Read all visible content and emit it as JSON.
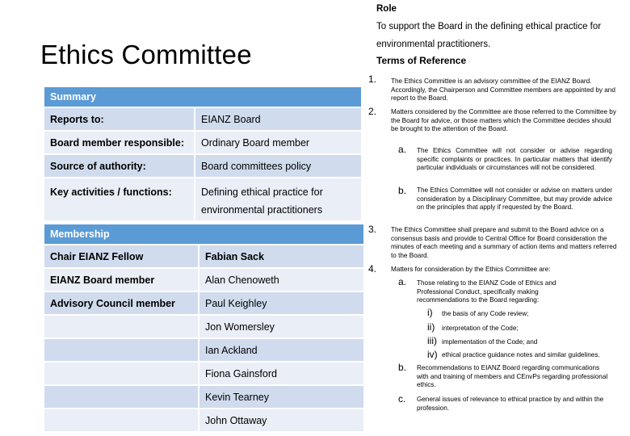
{
  "title": "Ethics Committee",
  "summary": {
    "header": "Summary",
    "rows": [
      {
        "label": "Reports to:",
        "value": "EIANZ Board"
      },
      {
        "label": "Board member responsible:",
        "value": "Ordinary Board member"
      },
      {
        "label": "Source of authority:",
        "value": "Board committees policy"
      },
      {
        "label": "Key activities / functions:",
        "value": "Defining ethical practice for environmental practitioners"
      }
    ]
  },
  "membership": {
    "header": "Membership",
    "rows": [
      {
        "role": "Chair EIANZ Fellow",
        "name": "Fabian Sack"
      },
      {
        "role": "EIANZ Board member",
        "name": "Alan Chenoweth"
      },
      {
        "role": "Advisory Council member",
        "name": "Paul Keighley"
      },
      {
        "role": "",
        "name": "Jon Womersley"
      },
      {
        "role": "",
        "name": "Ian Ackland"
      },
      {
        "role": "",
        "name": "Fiona Gainsford"
      },
      {
        "role": "",
        "name": "Kevin Tearney"
      },
      {
        "role": "",
        "name": "John Ottaway"
      }
    ]
  },
  "role": {
    "heading": "Role",
    "text": "To support the Board in the defining ethical practice for environmental practitioners."
  },
  "terms": {
    "heading": "Terms of Reference",
    "items": [
      {
        "num": "1.",
        "text": "The Ethics Committee is an advisory committee of the EIANZ Board. Accordingly, the Chairperson and Committee members are appointed by and report to the Board."
      },
      {
        "num": "2.",
        "text": "Matters considered by the Committee are those referred to the Committee by the Board for advice, or those matters which the Committee decides should be brought to the attention of the Board.",
        "sub": [
          {
            "num": "a.",
            "text": "The Ethics Committee will not consider or advise regarding specific complaints or practices. In particular matters that identify particular individuals or circumstances will not be considered."
          },
          {
            "num": "b.",
            "text": "The Ethics Committee will not consider or advise on matters under consideration by a Disciplinary Committee, but may provide advice on the principles that apply if requested by the Board."
          }
        ]
      },
      {
        "num": "3.",
        "text": "The Ethics Committee shall prepare and submit to the Board advice on a consensus basis and provide to Central Office for Board consideration the minutes of each meeting and a summary of action items and matters referred to the Board."
      },
      {
        "num": "4.",
        "text": "Matters for consideration by the Ethics Committee are:",
        "sub": [
          {
            "num": "a.",
            "text": "Those relating to the EIANZ Code of Ethics and Professional Conduct, specifically making recommendations to the Board regarding:",
            "sub": [
              {
                "num": "i)",
                "text": "the basis of any Code review;"
              },
              {
                "num": "ii)",
                "text": "interpretation of the Code;"
              },
              {
                "num": "iii)",
                "text": "implementation of the Code; and"
              },
              {
                "num": "iv)",
                "text": "ethical practice guidance notes and similar guidelines."
              }
            ]
          },
          {
            "num": "b.",
            "text": "Recommendations to EIANZ Board regarding communications with and training of members and CEnvPs regarding professional ethics."
          },
          {
            "num": "c.",
            "text": "General issues of relevance to ethical practice by and within the profession."
          }
        ]
      }
    ]
  }
}
